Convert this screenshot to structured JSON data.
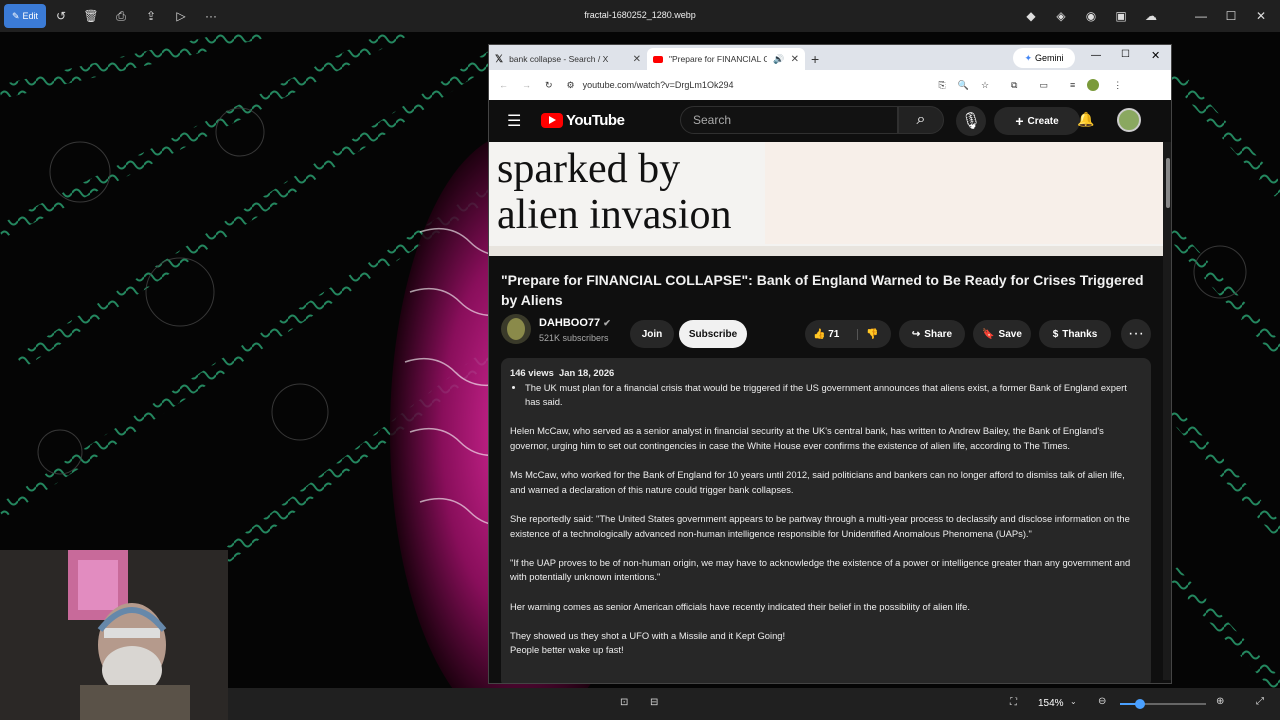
{
  "photos_app": {
    "edit_label": "Edit",
    "file_name": "fractal-1680252_1280.webp",
    "zoom": "154%"
  },
  "browser": {
    "tabs": [
      {
        "label": "bank collapse - Search / X"
      },
      {
        "label": "\"Prepare for FINANCIAL CO"
      }
    ],
    "gemini_label": "Gemini",
    "url": "youtube.com/watch?v=DrgLm1Ok294"
  },
  "youtube": {
    "logo_text": "YouTube",
    "search_placeholder": "Search",
    "create_label": "Create",
    "thumbnail_text_1": "sparked by",
    "thumbnail_text_2": "alien invasion",
    "video_title": "\"Prepare for FINANCIAL COLLAPSE\": Bank of England Warned to Be Ready for Crises Triggered by Aliens",
    "channel_name": "DAHBOO77",
    "subscribers": "521K subscribers",
    "join_label": "Join",
    "subscribe_label": "Subscribe",
    "likes": "71",
    "share_label": "Share",
    "save_label": "Save",
    "thanks_label": "Thanks",
    "views": "146 views",
    "date": "Jan 18, 2026",
    "bullet": "The UK must plan for a financial crisis that would be triggered if the US government announces that aliens exist, a former Bank of England expert has said.",
    "para1": "Helen McCaw, who served as a senior analyst in financial security at the UK's central bank, has written to Andrew Bailey, the Bank of England's governor, urging him to set out contingencies in case the White House ever confirms the existence of alien life, according to The Times.",
    "para2": "Ms McCaw, who worked for the Bank of England for 10 years until 2012, said politicians and bankers can no longer afford to dismiss talk of alien life, and warned a declaration of this nature could trigger bank collapses.",
    "para3": "She reportedly said: \"The United States government appears to be partway through a multi-year process to declassify and disclose information on the existence of a technologically advanced non-human intelligence responsible for Unidentified Anomalous Phenomena (UAPs).\"",
    "para4": "\"If the UAP proves to be of non-human origin, we may have to acknowledge the existence of a power or intelligence greater than any government and with potentially unknown intentions.\"",
    "para5": "Her warning comes as senior American officials have recently indicated their belief in the possibility of alien life.",
    "para6": "They showed us they shot a UFO with a Missile and it Kept Going!",
    "para7": "People better wake up fast!"
  }
}
